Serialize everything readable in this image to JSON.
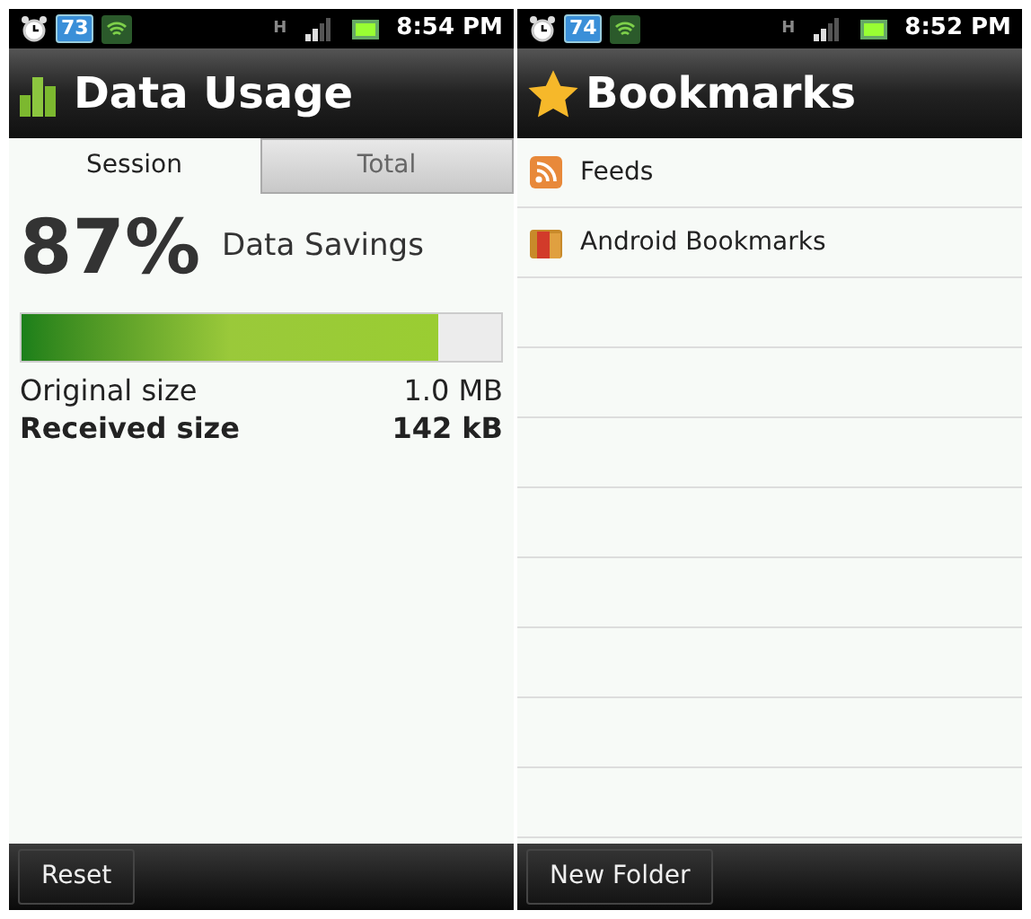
{
  "screens": [
    {
      "kind": "usage",
      "status_bar": {
        "badge": "73",
        "network": "H",
        "time": "8:54 PM"
      },
      "title": "Data Usage",
      "tabs": [
        {
          "label": "Session",
          "selected": true
        },
        {
          "label": "Total",
          "selected": false
        }
      ],
      "percent": "87%",
      "savings_label": "Data Savings",
      "level": 0.87,
      "stats": [
        {
          "label": "Original size",
          "value": "1.0 MB",
          "bold": false
        },
        {
          "label": "Received size",
          "value": "142 kB",
          "bold": true
        }
      ],
      "button": "Reset"
    },
    {
      "kind": "bookmarks",
      "status_bar": {
        "badge": "74",
        "network": "H",
        "time": "8:52 PM"
      },
      "title": "Bookmarks",
      "items": [
        {
          "label": "Feeds",
          "kind": "feed"
        },
        {
          "label": "Android Bookmarks",
          "kind": "folder"
        }
      ],
      "button": "New Folder"
    }
  ]
}
